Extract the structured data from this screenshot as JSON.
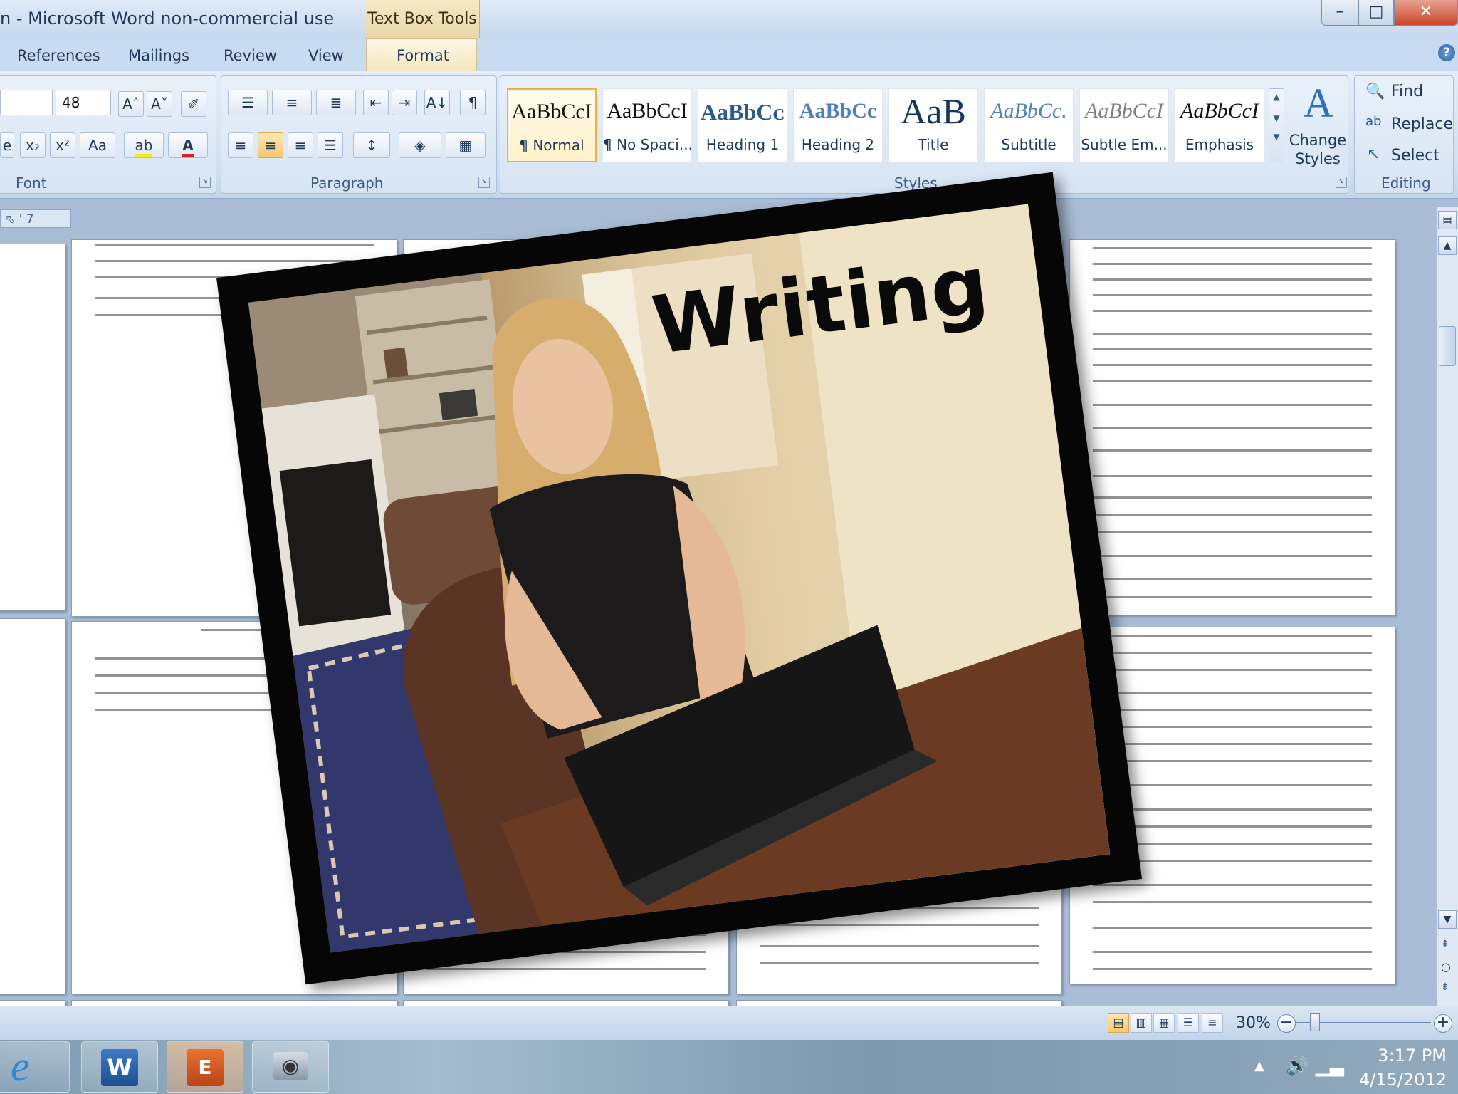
{
  "window": {
    "title": "n - Microsoft Word non-commercial use",
    "contextual_tab_group": "Text Box Tools",
    "controls": {
      "minimize": "–",
      "maximize": "□",
      "close": "✕"
    }
  },
  "tabs": [
    "References",
    "Mailings",
    "Review",
    "View",
    "Format"
  ],
  "active_tab": "Format",
  "ribbon": {
    "font": {
      "size_value": "48",
      "group_label": "Font",
      "btn_grow": "A˄",
      "btn_shrink": "A˅",
      "btn_subscript": "x₂",
      "btn_superscript": "x²",
      "btn_change_case": "Aa",
      "btn_highlight": "ab",
      "btn_font_color": "A",
      "highlight_color": "#f2ea10",
      "font_color": "#d92121"
    },
    "paragraph": {
      "group_label": "Paragraph",
      "btn_pilcrow": "¶",
      "btn_sort": "A↓"
    },
    "styles": {
      "group_label": "Styles",
      "items": [
        {
          "sample": "AaBbCcI",
          "name": "¶ Normal",
          "selected": true
        },
        {
          "sample": "AaBbCcI",
          "name": "¶ No Spaci...",
          "selected": false
        },
        {
          "sample": "AaBbCᴄ",
          "name": "Heading 1",
          "selected": false
        },
        {
          "sample": "AaBbCc",
          "name": "Heading 2",
          "selected": false
        },
        {
          "sample": "AaB",
          "name": "Title",
          "selected": false
        },
        {
          "sample": "AaBbCc.",
          "name": "Subtitle",
          "selected": false
        },
        {
          "sample": "AaBbCcI",
          "name": "Subtle Em...",
          "selected": false
        },
        {
          "sample": "AaBbCcI",
          "name": "Emphasis",
          "selected": false
        }
      ],
      "change_styles": "Change Styles"
    },
    "editing": {
      "group_label": "Editing",
      "find": "Find",
      "replace": "Replace",
      "select": "Select"
    }
  },
  "ruler": {
    "text": "⬁ ' 7"
  },
  "overlay": {
    "heading": "Writing"
  },
  "status": {
    "zoom_level": "30%"
  },
  "taskbar": {
    "apps": [
      "internet-explorer-icon",
      "word-icon",
      "presentation-icon",
      "camera-icon"
    ],
    "clock_time": "3:17 PM",
    "clock_date": "4/15/2012"
  },
  "colors": {
    "ribbon_blue": "#cfdeef",
    "selected_style": "#f0b13a",
    "frame": "#060606"
  }
}
